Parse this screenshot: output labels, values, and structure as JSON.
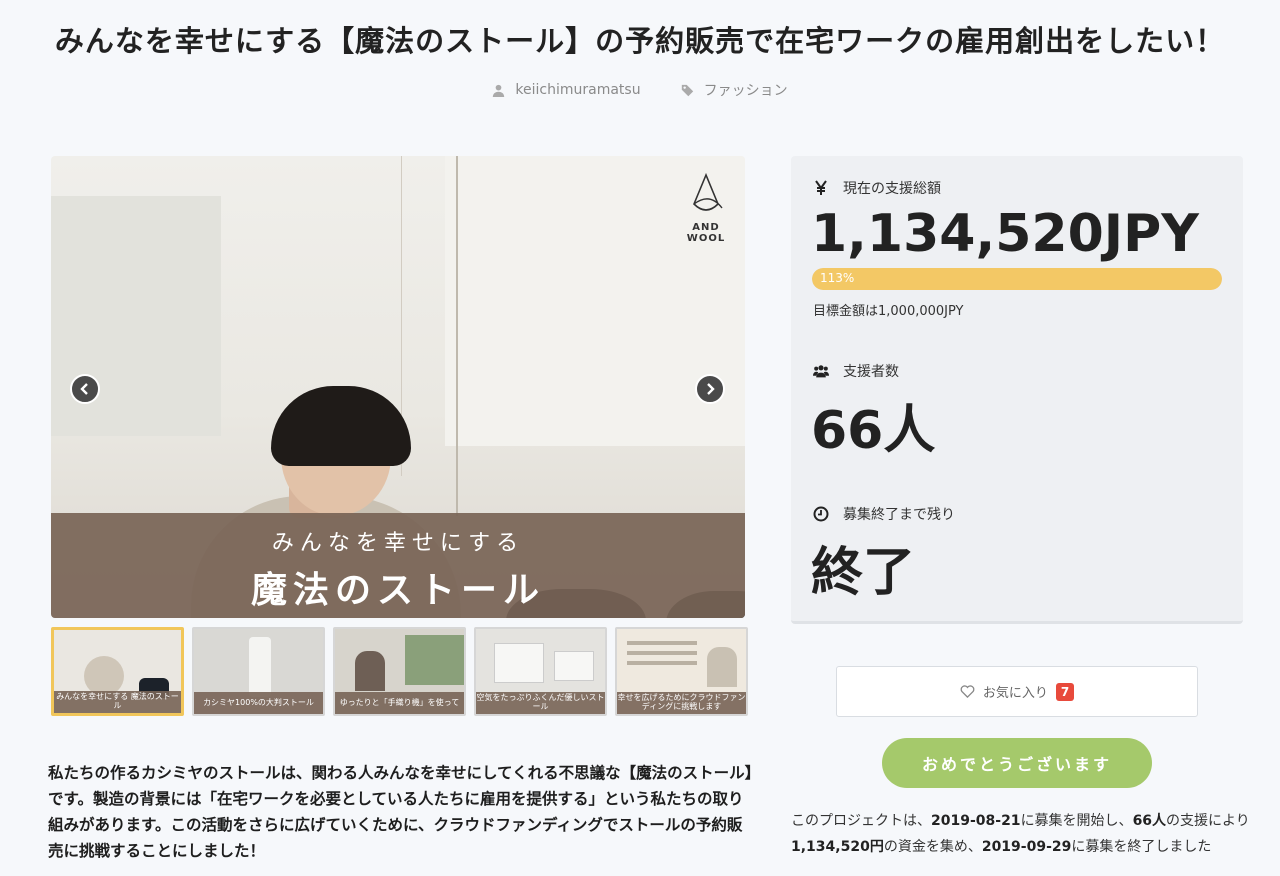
{
  "project": {
    "title": "みんなを幸せにする【魔法のストール】の予約販売で在宅ワークの雇用創出をしたい！",
    "author": "keiichimuramatsu",
    "category": "ファッション"
  },
  "slider": {
    "logo_text": "AND WOOL",
    "banner_line1": "みんなを幸せにする",
    "banner_line2": "魔法のストール",
    "prev_icon": "chevron-left-icon",
    "next_icon": "chevron-right-icon"
  },
  "thumbnails": [
    {
      "caption": "みんなを幸せにする 魔法のストール",
      "active": true
    },
    {
      "caption": "カシミヤ100%の大判ストール",
      "active": false
    },
    {
      "caption": "ゆったりと「手織り機」を使って",
      "active": false
    },
    {
      "caption": "空気をたっぷりふくんだ優しいストール",
      "active": false
    },
    {
      "caption": "幸せを広げるためにクラウドファンディングに挑戦します",
      "active": false
    }
  ],
  "description": "私たちの作るカシミヤのストールは、関わる人みんなを幸せにしてくれる不思議な【魔法のストール】です。製造の背景には「在宅ワークを必要としている人たちに雇用を提供する」という私たちの取り組みがあります。この活動をさらに広げていくために、クラウドファンディングでストールの予約販売に挑戦することにしました！",
  "stats": {
    "total_label": "現在の支援総額",
    "total_value": "1,134,520JPY",
    "progress_percent": 113,
    "progress_text": "113%",
    "goal_text": "目標金額は1,000,000JPY",
    "backers_label": "支援者数",
    "backers_value": "66人",
    "remaining_label": "募集終了まで残り",
    "remaining_value": "終了",
    "colors": {
      "progress": "#f3c865",
      "button": "#a5c96b",
      "badge": "#e84a3c"
    }
  },
  "favorite": {
    "label": "お気に入り",
    "count": "7"
  },
  "congrats_button": "おめでとうございます",
  "summary": {
    "p1": "このプロジェクトは、",
    "start_date": "2019-08-21",
    "p2": "に募集を開始し、",
    "backers": "66人",
    "p3": "の支援により",
    "amount": "1,134,520円",
    "p4": "の資金を集め、",
    "end_date": "2019-09-29",
    "p5": "に募集を終了しました"
  }
}
